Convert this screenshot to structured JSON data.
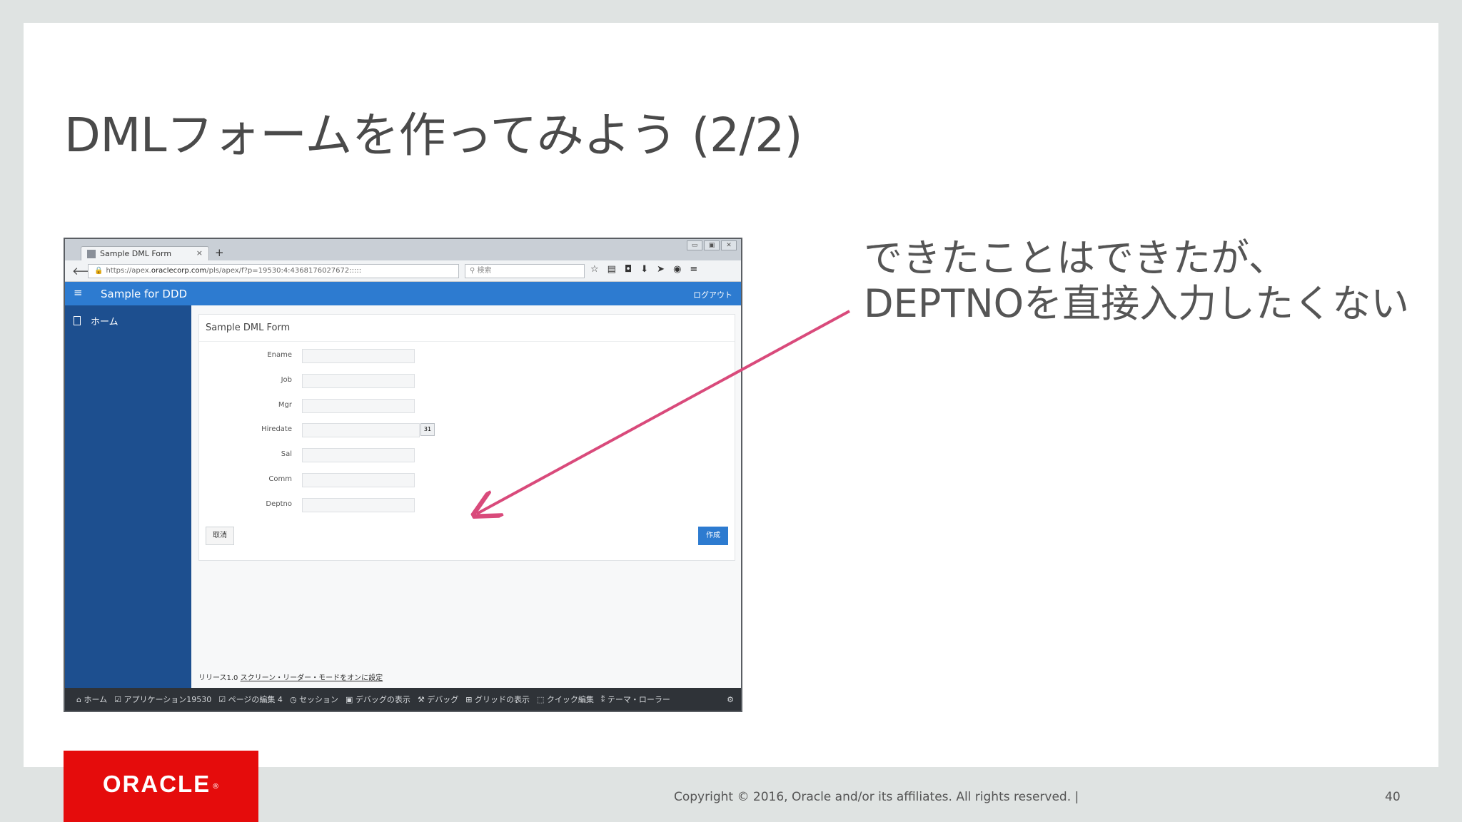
{
  "slide": {
    "title": "DMLフォームを作ってみよう (2/2)",
    "callout_line1": "できたことはできたが、",
    "callout_line2": "DEPTNOを直接入力したくない",
    "copyright": "Copyright © 2016, Oracle and/or its affiliates. All rights reserved.  |",
    "page_number": "40",
    "logo_text": "ORACLE",
    "arrow_color": "#d94a7b"
  },
  "browser": {
    "tab_title": "Sample DML Form",
    "tab_close": "×",
    "new_tab": "+",
    "url_prefix": "https://apex.",
    "url_domain": "oraclecorp.com",
    "url_rest": "/pls/apex/f?p=19530:4:4368176027672:::::",
    "search_placeholder": "検索"
  },
  "app": {
    "header_title": "Sample for DDD",
    "logout": "ログアウト",
    "nav_home": "ホーム",
    "region_title": "Sample DML Form",
    "fields": [
      {
        "label": "Ename"
      },
      {
        "label": "Job"
      },
      {
        "label": "Mgr"
      },
      {
        "label": "Hiredate"
      },
      {
        "label": "Sal"
      },
      {
        "label": "Comm"
      },
      {
        "label": "Deptno"
      }
    ],
    "cancel_label": "取消",
    "create_label": "作成",
    "release_text": "リリース1.0",
    "reader_link": "スクリーン・リーダー・モードをオンに設定"
  },
  "devbar": {
    "items": [
      "⌂ ホーム",
      "☑ アプリケーション19530",
      "☑ ページの編集 4",
      "◷ セッション",
      "▣ デバッグの表示",
      "⚒ デバッグ",
      "⊞ グリッドの表示",
      "⬚ クイック編集",
      "⁑ テーマ・ローラー"
    ]
  }
}
